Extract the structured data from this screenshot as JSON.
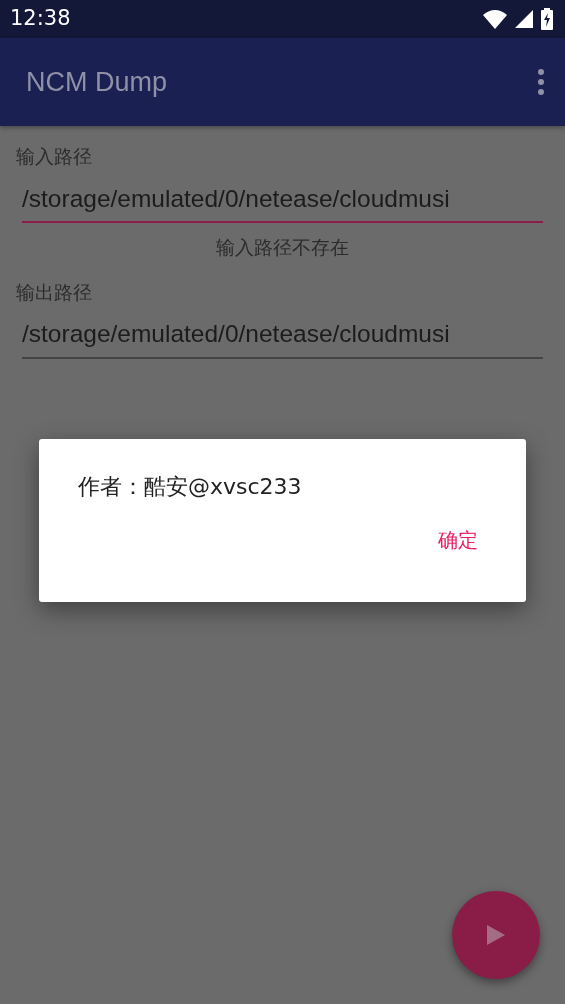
{
  "status_bar": {
    "time": "12:38"
  },
  "app_bar": {
    "title": "NCM Dump"
  },
  "fields": [
    {
      "label": "输入路径",
      "value": "/storage/emulated/0/netease/cloudmusi",
      "focused": true,
      "error": "输入路径不存在"
    },
    {
      "label": "输出路径",
      "value": "/storage/emulated/0/netease/cloudmusi",
      "focused": false
    }
  ],
  "dialog": {
    "message": "作者：酷安@xvsc233",
    "buttons": [
      "确定"
    ]
  }
}
